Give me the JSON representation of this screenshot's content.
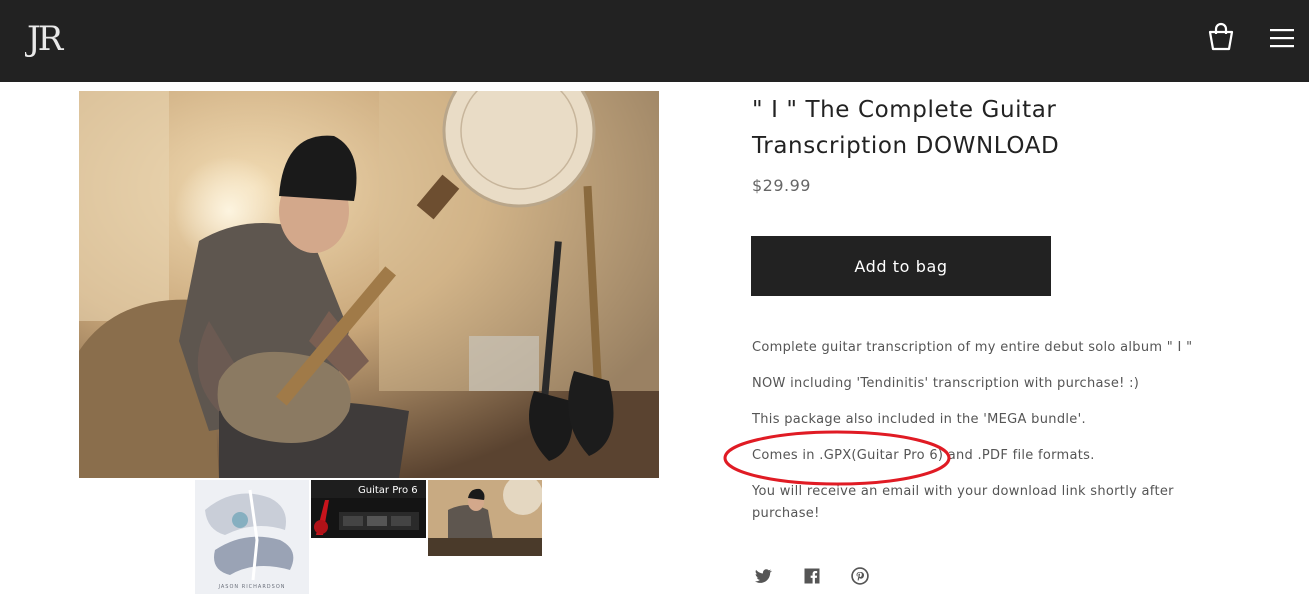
{
  "header": {
    "logo_text": "JR",
    "icons": {
      "bag": "shopping-bag-icon",
      "menu": "hamburger-menu-icon"
    },
    "background": "#222222"
  },
  "gallery": {
    "main_alt": "Guitarist playing electric guitar in studio",
    "thumbnails": [
      {
        "name": "album-cover-thumbnail",
        "text": "JASON RICHARDSON"
      },
      {
        "name": "guitar-pro-thumbnail",
        "text": "Guitar Pro 6"
      },
      {
        "name": "guitarist-photo-thumbnail",
        "text": ""
      }
    ]
  },
  "product": {
    "title": "\" I \" The Complete Guitar Transcription DOWNLOAD",
    "price": "$29.99",
    "add_to_bag_label": "Add to bag",
    "description": [
      "Complete guitar transcription of my entire debut solo album \" I \"",
      "NOW including 'Tendinitis' transcription with purchase! :)",
      "This package also included in the 'MEGA bundle'.",
      "Comes in .GPX(Guitar Pro 6) and .PDF file formats.",
      "You will receive an email with your download link shortly after purchase!"
    ]
  },
  "share": {
    "icons": [
      "twitter-icon",
      "facebook-icon",
      "pinterest-icon"
    ]
  },
  "colors": {
    "dark": "#222222",
    "annotation_red": "#e01b24",
    "text_muted": "#555555"
  }
}
